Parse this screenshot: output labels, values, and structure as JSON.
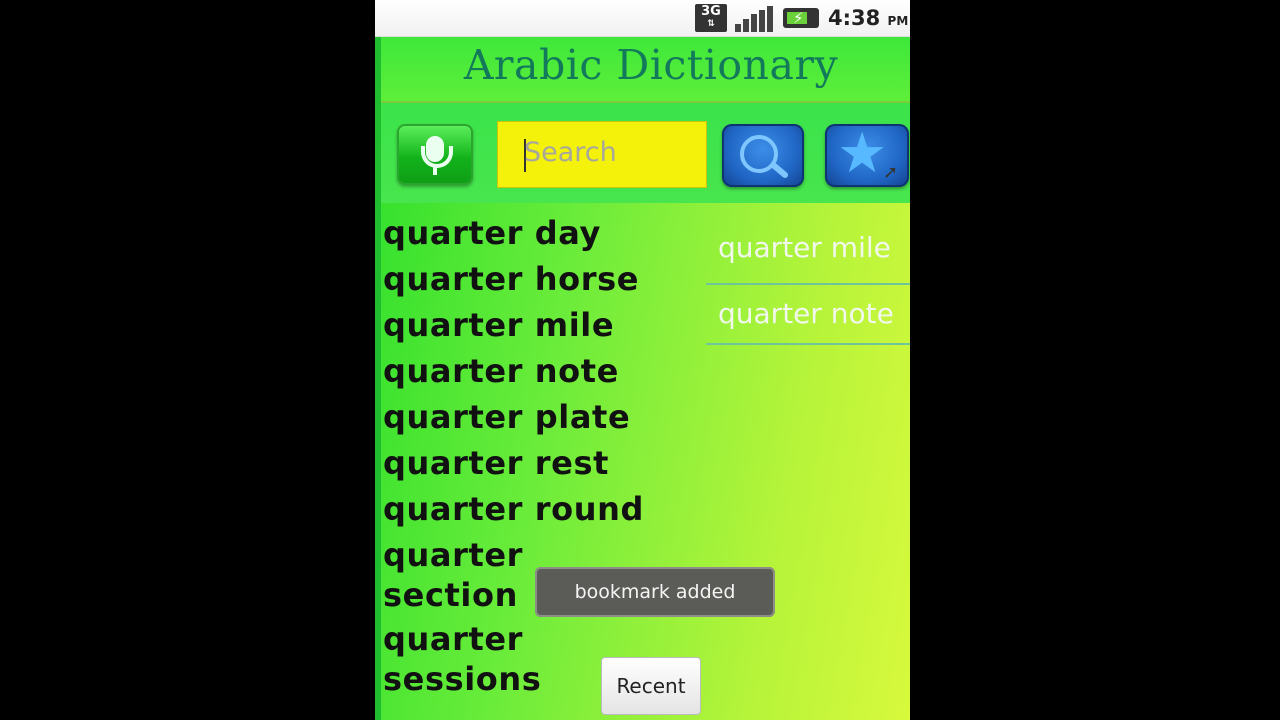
{
  "status_bar": {
    "network_label": "3G",
    "time": "4:38",
    "ampm": "PM"
  },
  "app": {
    "title": "Arabic Dictionary"
  },
  "toolbar": {
    "search_placeholder": "Search",
    "icons": {
      "mic": "microphone-icon",
      "search": "magnifier-icon",
      "bookmark": "star-icon"
    }
  },
  "word_list": [
    "quarter day",
    "quarter horse",
    "quarter mile",
    "quarter note",
    "quarter plate",
    "quarter rest",
    "quarter round",
    "quarter section",
    "quarter sessions"
  ],
  "side_panel": [
    "quarter mile",
    "quarter note"
  ],
  "toast": {
    "message": "bookmark added"
  },
  "buttons": {
    "recent_label": "Recent"
  },
  "colors": {
    "search_field": "#f4f10a",
    "title_text": "#127a5a",
    "button_blue": "#2066c4",
    "button_green": "#13b21b"
  }
}
